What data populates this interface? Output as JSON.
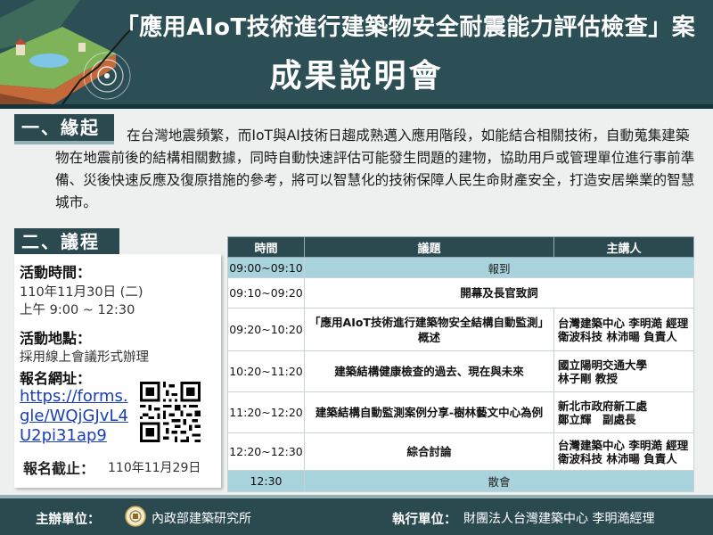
{
  "header": {
    "title_line1": "「應用AIoT技術進行建築物安全耐震能力評估檢查」案",
    "title_line2": "成果說明會"
  },
  "section1": {
    "heading": "一、緣起",
    "paragraph": "在台灣地震頻繁，而IoT與AI技術日趨成熟邁入應用階段，如能結合相關技術，自動蒐集建築物在地震前後的結構相關數據，同時自動快速評估可能發生問題的建物，協助用戶或管理單位進行事前準備、災後快速反應及復原措施的參考，將可以智慧化的技術保障人民生命財產安全，打造安居樂業的智慧城市。"
  },
  "section2": {
    "heading": "二、議程",
    "time_label": "活動時間：",
    "date": "110年11月30日 (二)",
    "time": "上午 9:00 ~ 12:30",
    "venue_label": "活動地點：",
    "venue": "採用線上會議形式辦理",
    "url_label": "報名網址：",
    "url": "https://forms.gle/WQjGJvL4U2pi31ap9",
    "deadline_label": "報名截止：",
    "deadline": "110年11月29日"
  },
  "agenda": {
    "headers": [
      "時間",
      "議題",
      "主講人"
    ],
    "rows": [
      {
        "time": "09:00~09:10",
        "topic": "報到",
        "speaker": "",
        "span": true
      },
      {
        "time": "09:10~09:20",
        "topic": "開幕及長官致詞",
        "speaker": "",
        "topic_span": true
      },
      {
        "time": "09:20~10:20",
        "topic": "「應用AIoT技術進行建築物安全結構自動監測」概述",
        "speaker": "台灣建築中心 李明澔 經理\n衛波科技 林沛暘 負責人"
      },
      {
        "time": "10:20~11:20",
        "topic": "建築結構健康檢查的過去、現在與未來",
        "speaker": "國立陽明交通大學\n林子剛 教授"
      },
      {
        "time": "11:20~12:20",
        "topic": "建築結構自動監測案例分享-樹林藝文中心為例",
        "speaker": "新北市政府新工處\n鄭立輝　副處長"
      },
      {
        "time": "12:20~12:30",
        "topic": "綜合討論",
        "speaker": "台灣建築中心 李明澔 經理\n衛波科技 林沛暘 負責人"
      },
      {
        "time": "12:30",
        "topic": "散會",
        "speaker": "",
        "span": true
      }
    ]
  },
  "footer": {
    "organizer_label": "主辦單位：",
    "organizer": "內政部建築研究所",
    "executor_label": "執行單位：",
    "executor": "財團法人台灣建築中心 李明澔經理"
  },
  "colors": {
    "primary": "#2b4a50",
    "accent": "#94b2b6",
    "highlight_row": "#a9d3dc",
    "link": "#1a3fb5"
  },
  "icons": [
    "earthquake-house-illustration",
    "qr-code",
    "government-seal-icon"
  ]
}
